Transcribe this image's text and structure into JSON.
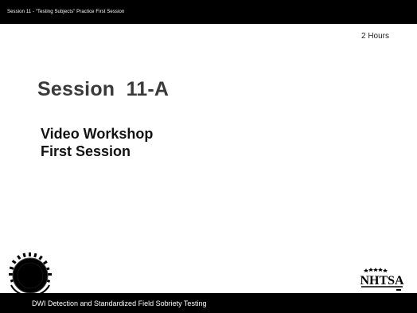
{
  "header": {
    "text": "Session 11 -  “Testing Subjects” Practice First Session"
  },
  "slide": {
    "duration": "2 Hours",
    "title": "Session  11-A",
    "subtitle_line1": "Video Workshop",
    "subtitle_line2": "First Session"
  },
  "logos": {
    "nhtsa_text": "NHTSA",
    "seal_icon": "agency-seal-icon",
    "nhtsa_icon": "nhtsa-logo-icon"
  },
  "footer": {
    "text": "DWI Detection and Standardized Field Sobriety Testing"
  },
  "colors": {
    "bars": "#000000",
    "title": "#3a3a3a",
    "subtitle": "#111111"
  }
}
